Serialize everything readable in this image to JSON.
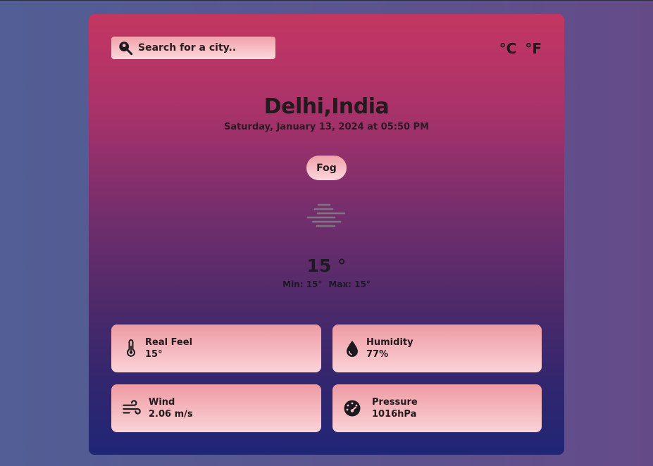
{
  "search": {
    "placeholder": "Search for a city.."
  },
  "units": {
    "celsius": "°C",
    "fahrenheit": "°F"
  },
  "location": {
    "city": "Delhi,India",
    "datetime": "Saturday, January 13, 2024 at 05:50 PM"
  },
  "condition": {
    "label": "Fog",
    "icon": "fog-icon"
  },
  "temperature": {
    "current": "15 °",
    "min": "Min: 15°",
    "max": "Max: 15°"
  },
  "details": [
    {
      "label": "Real Feel",
      "value": "15°",
      "icon": "thermometer-icon"
    },
    {
      "label": "Humidity",
      "value": "77%",
      "icon": "droplet-icon"
    },
    {
      "label": "Wind",
      "value": "2.06 m/s",
      "icon": "wind-icon"
    },
    {
      "label": "Pressure",
      "value": "1016hPa",
      "icon": "gauge-icon"
    }
  ],
  "colors": {
    "card_top": "#c43662",
    "card_bottom": "#1f2676",
    "tile_top": "#ee9aa2",
    "tile_bottom": "#fbd3d8",
    "text": "#221a1d"
  }
}
